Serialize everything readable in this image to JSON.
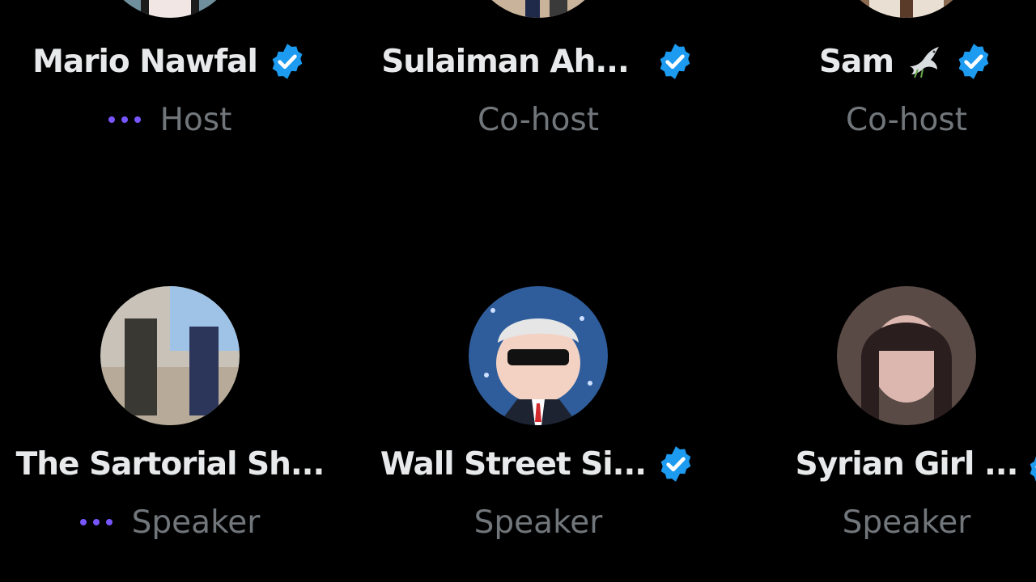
{
  "participants": [
    {
      "name": "Mario Nawfal",
      "verified": true,
      "role": "Host",
      "speaking": true,
      "avatar_icon": "pixel-art-avatar"
    },
    {
      "name": "Sulaiman Ah...",
      "verified": true,
      "role": "Co-host",
      "speaking": false,
      "avatar_icon": "photo-avatar"
    },
    {
      "name": "Sam",
      "emoji": "dove-icon",
      "verified": true,
      "role": "Co-host",
      "speaking": false,
      "avatar_icon": "photo-avatar"
    },
    {
      "name": "The Sartorial Sh...",
      "verified": false,
      "role": "Speaker",
      "speaking": true,
      "avatar_icon": "photo-avatar"
    },
    {
      "name": "Wall Street Si...",
      "verified": true,
      "role": "Speaker",
      "speaking": false,
      "avatar_icon": "cartoon-avatar"
    },
    {
      "name": "Syrian Girl ...",
      "verified": false,
      "role": "Speaker",
      "speaking": false,
      "avatar_icon": "photo-avatar"
    }
  ],
  "colors": {
    "background": "#000000",
    "name_text": "#e7e9ea",
    "role_text": "#71767b",
    "verified_badge": "#1d9bf0",
    "speaking_dots": "#7856ff"
  }
}
